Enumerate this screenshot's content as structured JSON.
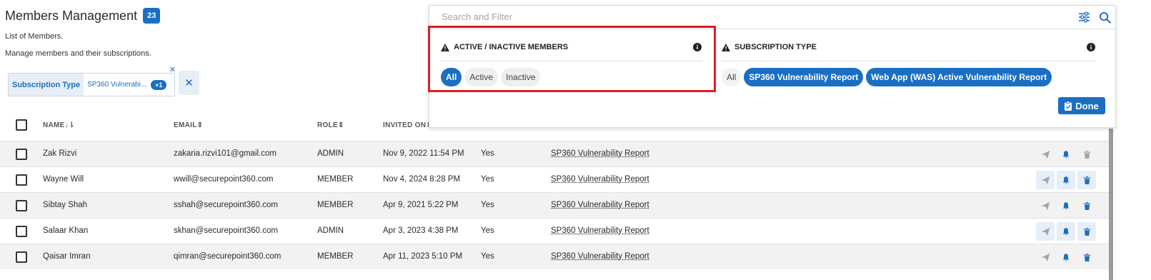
{
  "header": {
    "title": "Members Management",
    "count": "23",
    "subtitle_list": "List of Members.",
    "subtitle_manage": "Manage members and their subscriptions."
  },
  "active_filter": {
    "label": "Subscription Type",
    "value": "SP360 Vulnerabi...",
    "extra": "+1"
  },
  "table": {
    "headers": [
      "NAME",
      "EMAIL",
      "ROLE",
      "INVITED ON"
    ],
    "rows": [
      {
        "name": "Zak Rizvi",
        "email": "zakaria.rizvi101@gmail.com",
        "role": "ADMIN",
        "invited": "Nov 9, 2022 11:54 PM",
        "active": "Yes",
        "subscription": "SP360 Vulnerability Report"
      },
      {
        "name": "Wayne Will",
        "email": "wwill@securepoint360.com",
        "role": "MEMBER",
        "invited": "Nov 4, 2024 8:28 PM",
        "active": "Yes",
        "subscription": "SP360 Vulnerability Report"
      },
      {
        "name": "Sibtay Shah",
        "email": "sshah@securepoint360.com",
        "role": "MEMBER",
        "invited": "Apr 9, 2021 5:22 PM",
        "active": "Yes",
        "subscription": "SP360 Vulnerability Report"
      },
      {
        "name": "Salaar Khan",
        "email": "skhan@securepoint360.com",
        "role": "ADMIN",
        "invited": "Apr 3, 2023 4:38 PM",
        "active": "Yes",
        "subscription": "SP360 Vulnerability Report"
      },
      {
        "name": "Qaisar Imran",
        "email": "qimran@securepoint360.com",
        "role": "MEMBER",
        "invited": "Apr 11, 2023 5:10 PM",
        "active": "Yes",
        "subscription": "SP360 Vulnerability Report"
      }
    ]
  },
  "filter_panel": {
    "search_placeholder": "Search and Filter",
    "status_section": {
      "title": "ACTIVE / INACTIVE MEMBERS",
      "options": [
        "All",
        "Active",
        "Inactive"
      ],
      "selected": "All"
    },
    "subscription_section": {
      "title": "SUBSCRIPTION TYPE",
      "options": [
        "All",
        "SP360 Vulnerability Report",
        "Web App (WAS) Active Vulnerability Report"
      ],
      "selected": [
        "SP360 Vulnerability Report",
        "Web App (WAS) Active Vulnerability Report"
      ]
    },
    "done_label": "Done"
  },
  "colors": {
    "accent": "#1a6fc4",
    "highlight": "#e01b24",
    "row_shade": "#f2f2f2"
  },
  "icons": [
    "filter-settings-icon",
    "search-icon",
    "warning-icon",
    "info-icon",
    "close-icon",
    "send-icon",
    "bell-icon",
    "trash-icon",
    "clipboard-check-icon",
    "sort-icon"
  ]
}
